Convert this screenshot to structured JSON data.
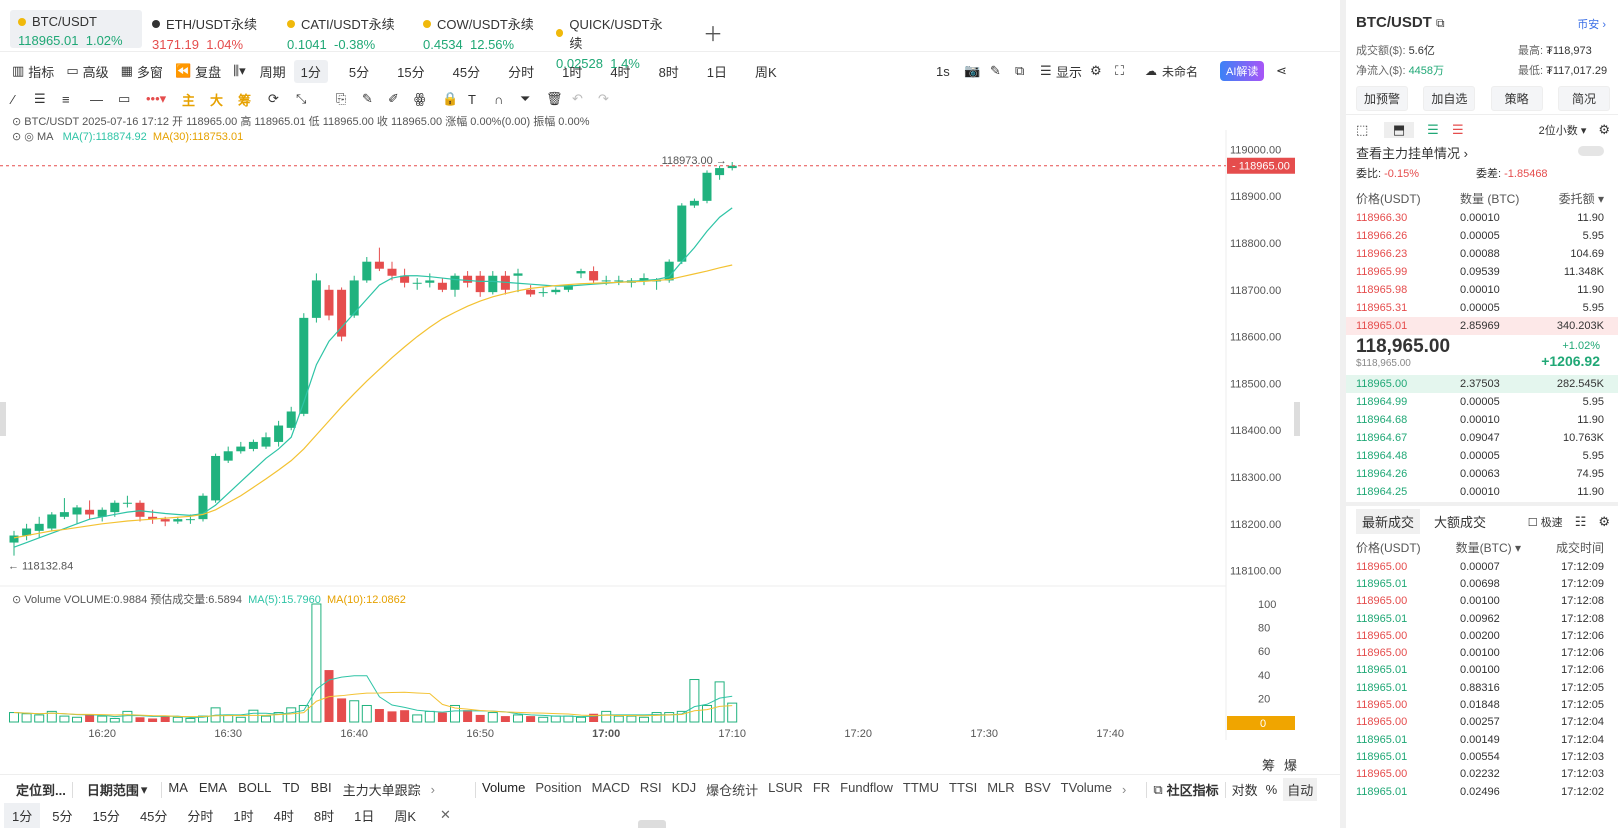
{
  "tabs": [
    {
      "name": "BTC/USDT",
      "price": "118965.01",
      "change": "1.02%",
      "dir": "up",
      "active": true,
      "dot": "#f0b90b"
    },
    {
      "name": "ETH/USDT永续",
      "price": "3171.19",
      "change": "1.04%",
      "dir": "down",
      "active": false,
      "dot": "#333"
    },
    {
      "name": "CATI/USDT永续",
      "price": "0.1041",
      "change": "-0.38%",
      "dir": "up",
      "active": false,
      "dot": "#f0b90b"
    },
    {
      "name": "COW/USDT永续",
      "price": "0.4534",
      "change": "12.56%",
      "dir": "up",
      "active": false,
      "dot": "#f0b90b"
    },
    {
      "name": "QUICK/USDT永续",
      "price": "0.02528",
      "change": "1.4%",
      "dir": "up",
      "active": false,
      "dot": "#f0b90b"
    }
  ],
  "toolbar": {
    "indicator": "指标",
    "advanced": "高级",
    "multi": "多窗",
    "replay": "复盘",
    "period": "周期",
    "intervals": [
      "1分",
      "5分",
      "15分",
      "45分",
      "分时",
      "1时",
      "4时",
      "8时",
      "1日",
      "周K"
    ],
    "active_interval": "1分",
    "sec": "1s",
    "display": "显示",
    "unnamed": "未命名",
    "ai": "AI解读"
  },
  "drawbar": {
    "main": "主",
    "big": "大",
    "chip": "筹"
  },
  "info": {
    "line1": "BTC/USDT  2025-07-16 17:12  开 118965.00  高 118965.01  低 118965.00  收 118965.00  涨幅 0.00%(0.00)  振幅 0.00%",
    "ma_label": "MA",
    "ma7": "MA(7):118874.92",
    "ma30": "MA(30):118753.01",
    "vol_label": "Volume  VOLUME:0.9884  预估成交量:6.5894",
    "vma5": "MA(5):15.7960",
    "vma10": "MA(10):12.0862"
  },
  "price_axis": [
    "119000.00",
    "118900.00",
    "118800.00",
    "118700.00",
    "118600.00",
    "118500.00",
    "118400.00",
    "118300.00",
    "118200.00",
    "118100.00"
  ],
  "vol_axis": [
    "100",
    "80",
    "60",
    "40",
    "20",
    "0"
  ],
  "time_axis": [
    "16:20",
    "16:30",
    "16:40",
    "16:50",
    "17:00",
    "17:10",
    "17:20",
    "17:30",
    "17:40"
  ],
  "current_price_tag": "118965.00",
  "high_mark": "118973.00",
  "low_mark": "118132.84",
  "colors": {
    "up": "#20b27e",
    "down": "#e54d4d",
    "ma7": "#2ec4a6",
    "ma30": "#f3c232"
  },
  "chart_data": {
    "type": "candlestick",
    "x": [
      "16:13",
      "16:14",
      "16:15",
      "16:16",
      "16:17",
      "16:18",
      "16:19",
      "16:20",
      "16:21",
      "16:22",
      "16:23",
      "16:24",
      "16:25",
      "16:26",
      "16:27",
      "16:28",
      "16:29",
      "16:30",
      "16:31",
      "16:32",
      "16:33",
      "16:34",
      "16:35",
      "16:36",
      "16:37",
      "16:38",
      "16:39",
      "16:40",
      "16:41",
      "16:42",
      "16:43",
      "16:44",
      "16:45",
      "16:46",
      "16:47",
      "16:48",
      "16:49",
      "16:50",
      "16:51",
      "16:52",
      "16:53",
      "16:54",
      "16:55",
      "16:56",
      "16:57",
      "16:58",
      "16:59",
      "17:00",
      "17:01",
      "17:02",
      "17:03",
      "17:04",
      "17:05",
      "17:06",
      "17:07",
      "17:08",
      "17:09",
      "17:10",
      "17:11",
      "17:12"
    ],
    "open": [
      118160,
      118175,
      118185,
      118190,
      118215,
      118220,
      118230,
      118215,
      118225,
      118245,
      118245,
      118215,
      118210,
      118205,
      118210,
      118210,
      118250,
      118335,
      118355,
      118360,
      118365,
      118375,
      118405,
      118435,
      118640,
      118700,
      118700,
      118645,
      118720,
      118760,
      118745,
      118730,
      118715,
      118715,
      118715,
      118700,
      118730,
      118730,
      118695,
      118730,
      118730,
      118700,
      118695,
      118695,
      118700,
      118735,
      118740,
      118720,
      118720,
      118715,
      118720,
      118720,
      118720,
      118760,
      118880,
      118890,
      118945,
      118960
    ],
    "close": [
      118175,
      118190,
      118200,
      118220,
      118225,
      118235,
      118220,
      118230,
      118245,
      118245,
      118215,
      118210,
      118205,
      118210,
      118210,
      118260,
      118345,
      118355,
      118365,
      118375,
      118385,
      118410,
      118440,
      118640,
      118720,
      118645,
      118600,
      118720,
      118760,
      118745,
      118730,
      118715,
      118715,
      118720,
      118700,
      118730,
      118715,
      118695,
      118730,
      118700,
      118735,
      118690,
      118695,
      118700,
      118710,
      118740,
      118720,
      118720,
      118720,
      118720,
      118725,
      118720,
      118760,
      118880,
      118890,
      118950,
      118960,
      118965
    ],
    "high": [
      118185,
      118200,
      118215,
      118225,
      118255,
      118240,
      118250,
      118235,
      118250,
      118260,
      118250,
      118230,
      118215,
      118215,
      118220,
      118265,
      118350,
      118365,
      118375,
      118380,
      118395,
      118420,
      118450,
      118650,
      118735,
      118710,
      118705,
      118730,
      118770,
      118790,
      118760,
      118745,
      118725,
      118735,
      118725,
      118735,
      118740,
      118740,
      118740,
      118740,
      118745,
      118710,
      118705,
      118705,
      118710,
      118745,
      118750,
      118730,
      118730,
      118725,
      118735,
      118725,
      118765,
      118885,
      118895,
      118955,
      118965,
      118973
    ],
    "low": [
      118132,
      118165,
      118170,
      118185,
      118210,
      118200,
      118210,
      118205,
      118215,
      118235,
      118205,
      118200,
      118195,
      118200,
      118200,
      118205,
      118245,
      118330,
      118350,
      118355,
      118360,
      118365,
      118400,
      118430,
      118630,
      118635,
      118590,
      118640,
      118715,
      118740,
      118720,
      118705,
      118700,
      118705,
      118695,
      118685,
      118705,
      118685,
      118690,
      118690,
      118695,
      118685,
      118685,
      118690,
      118695,
      118725,
      118715,
      118710,
      118710,
      118705,
      118710,
      118700,
      118715,
      118755,
      118875,
      118885,
      118935,
      118955
    ],
    "volume": [
      8,
      7,
      6,
      9,
      5,
      4,
      6,
      5,
      3,
      9,
      4,
      3,
      5,
      4,
      3,
      5,
      12,
      6,
      4,
      10,
      5,
      8,
      12,
      14,
      100,
      44,
      20,
      18,
      14,
      11,
      9,
      10,
      6,
      9,
      8,
      14,
      10,
      6,
      8,
      5,
      6,
      5,
      4,
      5,
      5,
      4,
      7,
      9,
      5,
      5,
      4,
      8,
      8,
      9,
      36,
      14,
      34,
      16
    ],
    "ma7": [
      118150,
      118160,
      118170,
      118180,
      118190,
      118200,
      118210,
      118215,
      118220,
      118225,
      118228,
      118225,
      118222,
      118220,
      118218,
      118222,
      118240,
      118265,
      118290,
      118315,
      118340,
      118360,
      118385,
      118460,
      118540,
      118590,
      118620,
      118650,
      118680,
      118710,
      118725,
      118730,
      118730,
      118728,
      118725,
      118722,
      118720,
      118718,
      118718,
      118716,
      118714,
      118712,
      118710,
      118708,
      118708,
      118710,
      118712,
      118714,
      118716,
      118718,
      118720,
      118722,
      118728,
      118760,
      118790,
      118825,
      118855,
      118875
    ],
    "ma30": [
      118170,
      118175,
      118180,
      118185,
      118188,
      118192,
      118196,
      118200,
      118203,
      118206,
      118208,
      118210,
      118212,
      118214,
      118216,
      118220,
      118230,
      118245,
      118260,
      118278,
      118296,
      118315,
      118335,
      118360,
      118390,
      118420,
      118450,
      118478,
      118505,
      118530,
      118555,
      118578,
      118600,
      118620,
      118638,
      118652,
      118665,
      118676,
      118685,
      118692,
      118698,
      118703,
      118706,
      118709,
      118711,
      118713,
      118714,
      118715,
      118716,
      118717,
      118718,
      118720,
      118722,
      118728,
      118734,
      118740,
      118747,
      118753
    ],
    "ylim": [
      118080,
      119020
    ]
  },
  "bottom": {
    "locate": "定位到...",
    "range": "日期范围",
    "main_ind": [
      "MA",
      "EMA",
      "BOLL",
      "TD",
      "BBI",
      "主力大单跟踪"
    ],
    "sub_ind": [
      "Volume",
      "Position",
      "MACD",
      "RSI",
      "KDJ",
      "爆仓统计",
      "LSUR",
      "FR",
      "Fundflow",
      "TTMU",
      "TTSI",
      "MLR",
      "BSV",
      "TVolume"
    ],
    "community": "社区指标",
    "log": "对数",
    "pct": "%",
    "auto": "自动",
    "chou": "筹",
    "bao": "爆",
    "intervals2": [
      "1分",
      "5分",
      "15分",
      "45分",
      "分时",
      "1时",
      "4时",
      "8时",
      "1日",
      "周K"
    ]
  },
  "side": {
    "pair": "BTC/USDT",
    "exchange": "币安",
    "turnover_label": "成交额($):",
    "turnover": "5.6亿",
    "high_label": "最高:",
    "high": "₮118,973",
    "inflow_label": "净流入($):",
    "inflow": "4458万",
    "low_label": "最低:",
    "low": "₮117,017.29",
    "buttons": [
      "加预警",
      "加自选",
      "策略",
      "简况"
    ],
    "decimals": "2位小数",
    "main_orders": "查看主力挂单情况",
    "ratio_label": "委比:",
    "ratio": "-0.15%",
    "diff_label": "委差:",
    "diff": "-1.85468",
    "ob_headers": [
      "价格(USDT)",
      "数量 (BTC)",
      "委托额"
    ],
    "asks": [
      [
        "118966.30",
        "0.00010",
        "11.90"
      ],
      [
        "118966.26",
        "0.00005",
        "5.95"
      ],
      [
        "118966.23",
        "0.00088",
        "104.69"
      ],
      [
        "118965.99",
        "0.09539",
        "11.348K"
      ],
      [
        "118965.98",
        "0.00010",
        "11.90"
      ],
      [
        "118965.31",
        "0.00005",
        "5.95"
      ],
      [
        "118965.01",
        "2.85969",
        "340.203K"
      ]
    ],
    "last_price": "118,965.00",
    "last_usd": "$118,965.00",
    "last_pct": "+1.02%",
    "last_chg": "+1206.92",
    "bids": [
      [
        "118965.00",
        "2.37503",
        "282.545K"
      ],
      [
        "118964.99",
        "0.00005",
        "5.95"
      ],
      [
        "118964.68",
        "0.00010",
        "11.90"
      ],
      [
        "118964.67",
        "0.09047",
        "10.763K"
      ],
      [
        "118964.48",
        "0.00005",
        "5.95"
      ],
      [
        "118964.26",
        "0.00063",
        "74.95"
      ],
      [
        "118964.25",
        "0.00010",
        "11.90"
      ]
    ],
    "trade_tabs": [
      "最新成交",
      "大额成交"
    ],
    "fast": "极速",
    "trade_headers": [
      "价格(USDT)",
      "数量(BTC)",
      "成交时间"
    ],
    "trades": [
      [
        "118965.00",
        "0.00007",
        "17:12:09",
        "down"
      ],
      [
        "118965.01",
        "0.00698",
        "17:12:09",
        "up"
      ],
      [
        "118965.00",
        "0.00100",
        "17:12:08",
        "down"
      ],
      [
        "118965.01",
        "0.00962",
        "17:12:08",
        "up"
      ],
      [
        "118965.00",
        "0.00200",
        "17:12:06",
        "down"
      ],
      [
        "118965.00",
        "0.00100",
        "17:12:06",
        "down"
      ],
      [
        "118965.01",
        "0.00100",
        "17:12:06",
        "up"
      ],
      [
        "118965.01",
        "0.88316",
        "17:12:05",
        "up"
      ],
      [
        "118965.00",
        "0.01848",
        "17:12:05",
        "down"
      ],
      [
        "118965.00",
        "0.00257",
        "17:12:04",
        "down"
      ],
      [
        "118965.01",
        "0.00149",
        "17:12:04",
        "up"
      ],
      [
        "118965.01",
        "0.00554",
        "17:12:03",
        "up"
      ],
      [
        "118965.00",
        "0.02232",
        "17:12:03",
        "down"
      ],
      [
        "118965.01",
        "0.02496",
        "17:12:02",
        "up"
      ]
    ]
  }
}
